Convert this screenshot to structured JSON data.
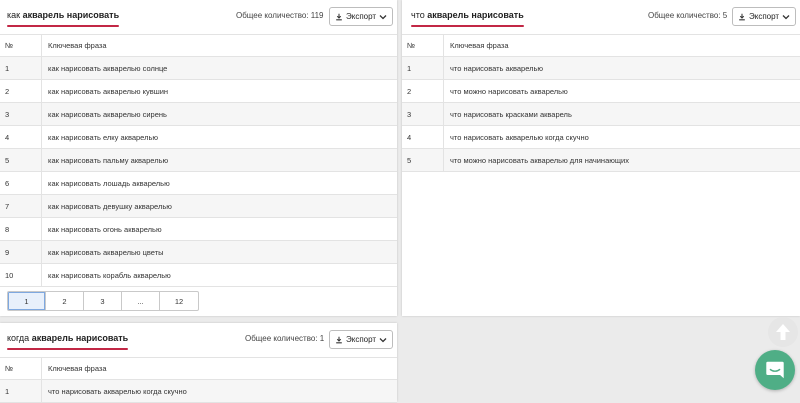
{
  "panels": [
    {
      "title_prefix": "как ",
      "title_bold": "акварель нарисовать",
      "count_label": "Общее количество: 119",
      "export_label": "Экспорт",
      "columns": [
        "№",
        "Ключевая фраза"
      ],
      "rows": [
        [
          "1",
          "как нарисовать акварелью солнце"
        ],
        [
          "2",
          "как нарисовать акварелью кувшин"
        ],
        [
          "3",
          "как нарисовать акварелью сирень"
        ],
        [
          "4",
          "как нарисовать елку акварелью"
        ],
        [
          "5",
          "как нарисовать пальму акварелью"
        ],
        [
          "6",
          "как нарисовать лошадь акварелью"
        ],
        [
          "7",
          "как нарисовать девушку акварелью"
        ],
        [
          "8",
          "как нарисовать огонь акварелью"
        ],
        [
          "9",
          "как нарисовать акварелью цветы"
        ],
        [
          "10",
          "как нарисовать корабль акварелью"
        ]
      ],
      "pagination": [
        "1",
        "2",
        "3",
        "...",
        "12"
      ]
    },
    {
      "title_prefix": "что ",
      "title_bold": "акварель нарисовать",
      "count_label": "Общее количество: 5",
      "export_label": "Экспорт",
      "columns": [
        "№",
        "Ключевая фраза"
      ],
      "rows": [
        [
          "1",
          "что нарисовать акварелью"
        ],
        [
          "2",
          "что можно нарисовать акварелью"
        ],
        [
          "3",
          "что нарисовать красками акварель"
        ],
        [
          "4",
          "что нарисовать акварелью когда скучно"
        ],
        [
          "5",
          "что можно нарисовать акварелью для начинающих"
        ]
      ]
    },
    {
      "title_prefix": "когда ",
      "title_bold": "акварель нарисовать",
      "count_label": "Общее количество: 1",
      "export_label": "Экспорт",
      "columns": [
        "№",
        "Ключевая фраза"
      ],
      "rows": [
        [
          "1",
          "что нарисовать акварелью когда скучно"
        ]
      ]
    }
  ],
  "icons": {
    "export": "download-icon",
    "dropdown": "chevron-down-icon",
    "scroll_top": "arrow-up-icon",
    "chat": "chat-icon"
  },
  "colors": {
    "title_underline": "#c22745",
    "chat_button": "#4fae86",
    "active_page": "#e8f0fb"
  }
}
